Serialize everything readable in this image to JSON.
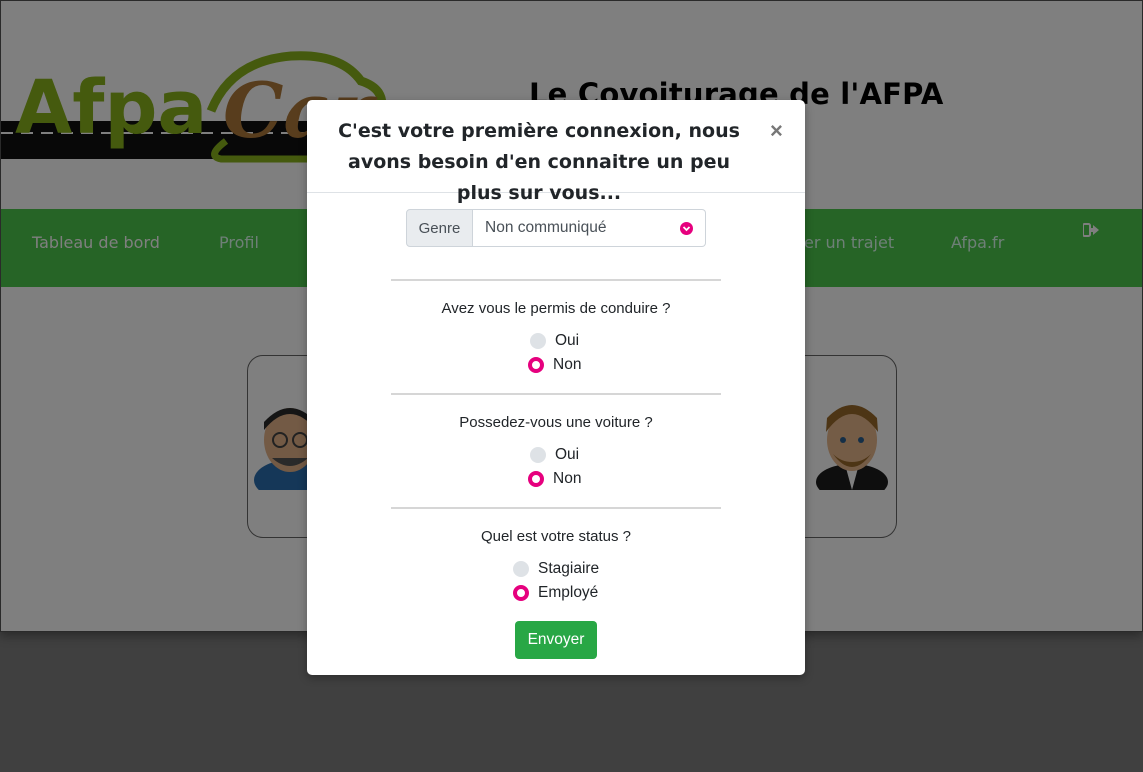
{
  "site": {
    "logo_text_left": "Afpa",
    "logo_text_right": "Car",
    "title": "Le Covoiturage de l'AFPA"
  },
  "nav": {
    "items": [
      {
        "label": "Tableau de bord"
      },
      {
        "label": "Profil"
      },
      {
        "label": "er un trajet"
      },
      {
        "label": "Afpa.fr"
      }
    ],
    "logout_icon": "sign-out-icon"
  },
  "modal": {
    "title": "C'est votre première connexion, nous avons besoin d'en connaitre un peu plus sur vous...",
    "close_label": "×",
    "genre": {
      "label": "Genre",
      "selected": "Non communiqué"
    },
    "questions": [
      {
        "text": "Avez vous le permis de conduire ?",
        "options": [
          {
            "label": "Oui",
            "checked": false
          },
          {
            "label": "Non",
            "checked": true
          }
        ]
      },
      {
        "text": "Possedez-vous une voiture ?",
        "options": [
          {
            "label": "Oui",
            "checked": false
          },
          {
            "label": "Non",
            "checked": true
          }
        ]
      },
      {
        "text": "Quel est votre status ?",
        "options": [
          {
            "label": "Stagiaire",
            "checked": false
          },
          {
            "label": "Employé",
            "checked": true
          }
        ]
      }
    ],
    "submit_label": "Envoyer"
  },
  "colors": {
    "accent": "#e6007e",
    "submit": "#28a745",
    "navbar": "#4cc84c",
    "logo_green": "#8ab51d",
    "logo_brown": "#b07a3a"
  }
}
